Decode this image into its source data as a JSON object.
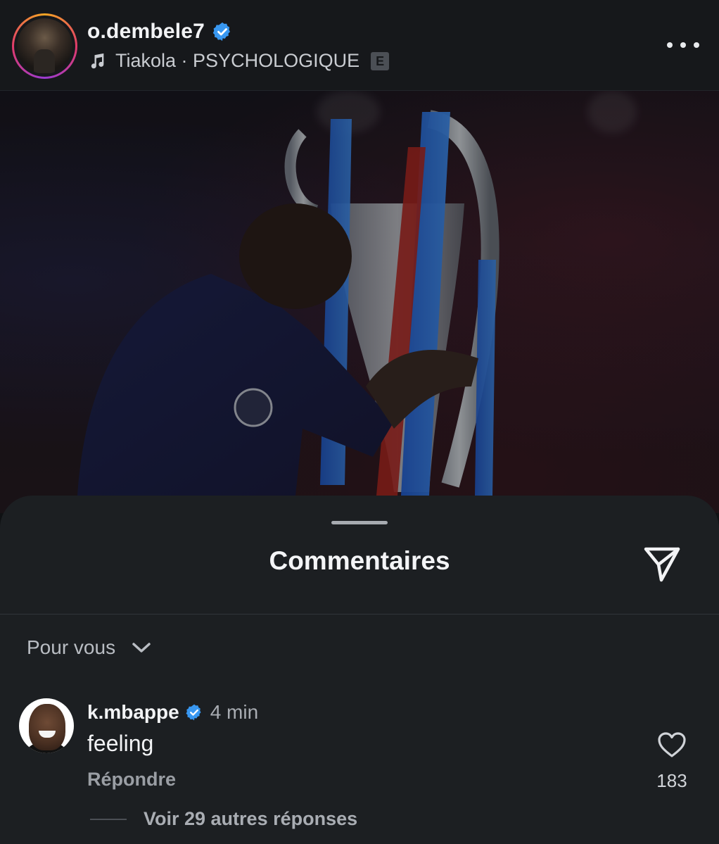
{
  "post": {
    "username": "o.dembele7",
    "music_artist": "Tiakola",
    "music_separator": " · ",
    "music_title": "PSYCHOLOGIQUE",
    "explicit_badge": "E"
  },
  "comments_sheet": {
    "title": "Commentaires",
    "filter_label": "Pour vous",
    "comments": [
      {
        "username": "k.mbappe",
        "time": "4 min",
        "text": "feeling",
        "reply_label": "Répondre",
        "like_count": "183",
        "more_replies_label": "Voir 29 autres réponses"
      }
    ]
  },
  "icons": {
    "verified": "verified-badge-icon",
    "music": "music-note-icon",
    "more": "more-options-icon",
    "share": "share-send-icon",
    "chevron": "chevron-down-icon",
    "like": "heart-outline-icon"
  },
  "colors": {
    "background": "#0f1113",
    "sheet": "#1c1f22",
    "verified_blue": "#3897f0",
    "text_primary": "#f2f3f5",
    "text_secondary": "#a9adb3"
  }
}
